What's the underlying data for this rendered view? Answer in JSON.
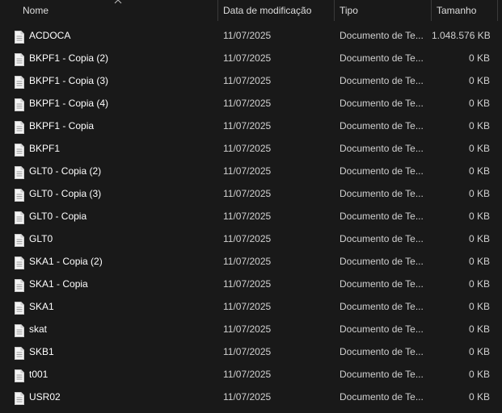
{
  "columns": {
    "name": "Nome",
    "date": "Data de modificação",
    "type": "Tipo",
    "size": "Tamanho"
  },
  "icons": {
    "file": "text-document-icon",
    "sort": "sort-ascending-caret-icon"
  },
  "colors": {
    "background": "#191919",
    "text": "#ffffff",
    "muted_text": "#d0d0d0",
    "divider": "#3a3a3a"
  },
  "files": [
    {
      "name": "ACDOCA",
      "date": "11/07/2025",
      "type": "Documento de Te...",
      "size": "1.048.576 KB"
    },
    {
      "name": "BKPF1 - Copia (2)",
      "date": "11/07/2025",
      "type": "Documento de Te...",
      "size": "0 KB"
    },
    {
      "name": "BKPF1 - Copia (3)",
      "date": "11/07/2025",
      "type": "Documento de Te...",
      "size": "0 KB"
    },
    {
      "name": "BKPF1 - Copia (4)",
      "date": "11/07/2025",
      "type": "Documento de Te...",
      "size": "0 KB"
    },
    {
      "name": "BKPF1 - Copia",
      "date": "11/07/2025",
      "type": "Documento de Te...",
      "size": "0 KB"
    },
    {
      "name": "BKPF1",
      "date": "11/07/2025",
      "type": "Documento de Te...",
      "size": "0 KB"
    },
    {
      "name": "GLT0 - Copia (2)",
      "date": "11/07/2025",
      "type": "Documento de Te...",
      "size": "0 KB"
    },
    {
      "name": "GLT0 - Copia (3)",
      "date": "11/07/2025",
      "type": "Documento de Te...",
      "size": "0 KB"
    },
    {
      "name": "GLT0 - Copia",
      "date": "11/07/2025",
      "type": "Documento de Te...",
      "size": "0 KB"
    },
    {
      "name": "GLT0",
      "date": "11/07/2025",
      "type": "Documento de Te...",
      "size": "0 KB"
    },
    {
      "name": "SKA1 - Copia (2)",
      "date": "11/07/2025",
      "type": "Documento de Te...",
      "size": "0 KB"
    },
    {
      "name": "SKA1 - Copia",
      "date": "11/07/2025",
      "type": "Documento de Te...",
      "size": "0 KB"
    },
    {
      "name": "SKA1",
      "date": "11/07/2025",
      "type": "Documento de Te...",
      "size": "0 KB"
    },
    {
      "name": "skat",
      "date": "11/07/2025",
      "type": "Documento de Te...",
      "size": "0 KB"
    },
    {
      "name": "SKB1",
      "date": "11/07/2025",
      "type": "Documento de Te...",
      "size": "0 KB"
    },
    {
      "name": "t001",
      "date": "11/07/2025",
      "type": "Documento de Te...",
      "size": "0 KB"
    },
    {
      "name": "USR02",
      "date": "11/07/2025",
      "type": "Documento de Te...",
      "size": "0 KB"
    }
  ]
}
